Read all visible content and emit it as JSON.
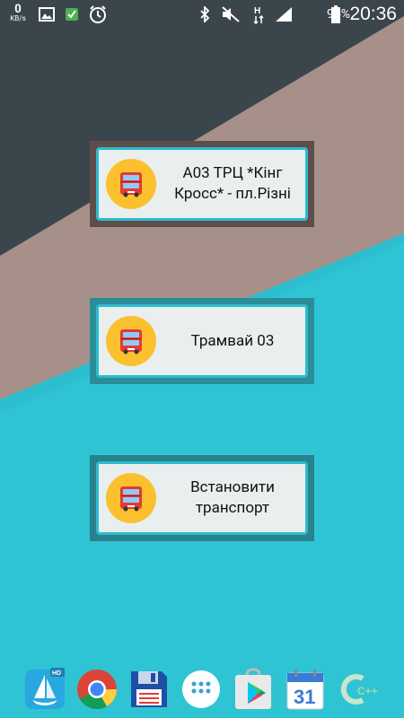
{
  "status_bar": {
    "speed_value": "0",
    "speed_unit": "KB/s",
    "battery_percent": "94%",
    "time": "20:36"
  },
  "widgets": [
    {
      "label": "А03 ТРЦ *Кінг\nКросс* - пл.Різні"
    },
    {
      "label": "Трамвай 03"
    },
    {
      "label": "Встановити\nтранспорт"
    }
  ],
  "dock": {
    "apps": [
      {
        "icon": "boat-browser-icon",
        "badge": "HD"
      },
      {
        "icon": "chrome-icon"
      },
      {
        "icon": "floppy-save-icon"
      },
      {
        "icon": "app-drawer-icon"
      },
      {
        "icon": "play-store-icon"
      },
      {
        "icon": "calendar-icon",
        "text": "31"
      },
      {
        "icon": "cpp-app-icon",
        "text": "C++"
      }
    ]
  },
  "colors": {
    "dark_panel": "#3b464c",
    "beige_panel": "#a69089",
    "teal_panel": "#2ec4d4",
    "widget_border": "#2bbccf",
    "bus_circle": "#fbc02d"
  }
}
